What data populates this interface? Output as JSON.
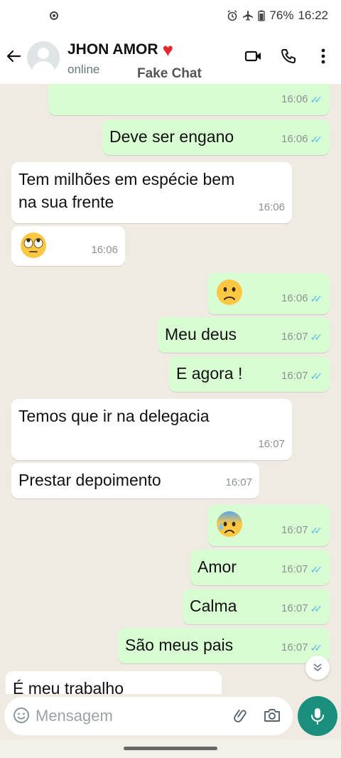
{
  "status_bar": {
    "battery": "76%",
    "time": "16:22",
    "icons": [
      "record-icon",
      "alarm-icon",
      "airplane-icon",
      "battery-icon"
    ]
  },
  "header": {
    "contact_name": "JHON AMOR",
    "heart_emoji": "❤️",
    "status": "online",
    "watermark": "Fake Chat",
    "icons": [
      "back-arrow-icon",
      "video-call-icon",
      "phone-icon",
      "more-options-icon"
    ]
  },
  "messages": [
    {
      "dir": "out",
      "text": "",
      "time": "16:06",
      "ticks": "✓✓"
    },
    {
      "dir": "out",
      "text": "Deve ser engano",
      "time": "16:06",
      "ticks": "✓✓"
    },
    {
      "dir": "in",
      "text": "Tem milhões em espécie bem na sua frente",
      "time": "16:06"
    },
    {
      "dir": "in",
      "emoji": "eye-roll-emoji",
      "time": "16:06"
    },
    {
      "dir": "out",
      "emoji": "worried-face-emoji",
      "time": "16:06",
      "ticks": "✓✓"
    },
    {
      "dir": "out",
      "text": "Meu deus",
      "time": "16:07",
      "ticks": "✓✓"
    },
    {
      "dir": "out",
      "text": "E agora !",
      "time": "16:07",
      "ticks": "✓✓"
    },
    {
      "dir": "in",
      "text": "Temos que ir na delegacia",
      "time": "16:07"
    },
    {
      "dir": "in",
      "text": "Prestar depoimento",
      "time": "16:07"
    },
    {
      "dir": "out",
      "emoji": "anxious-sweat-emoji",
      "time": "16:07",
      "ticks": "✓✓"
    },
    {
      "dir": "out",
      "text": "Amor",
      "time": "16:07",
      "ticks": "✓✓"
    },
    {
      "dir": "out",
      "text": "Calma",
      "time": "16:07",
      "ticks": "✓✓"
    },
    {
      "dir": "out",
      "text": "São meus pais",
      "time": "16:07",
      "ticks": "✓✓"
    },
    {
      "dir": "in",
      "text": "É meu trabalho"
    }
  ],
  "input": {
    "placeholder": "Mensagem",
    "icons": [
      "emoji-icon",
      "attach-icon",
      "camera-icon",
      "microphone-icon",
      "scroll-down-icon"
    ]
  },
  "colors": {
    "outgoing_bubble": "#d9fdd3",
    "incoming_bubble": "#ffffff",
    "chat_background": "#efeae2",
    "read_ticks": "#53bdeb",
    "mic_button": "#1a8f7d"
  }
}
